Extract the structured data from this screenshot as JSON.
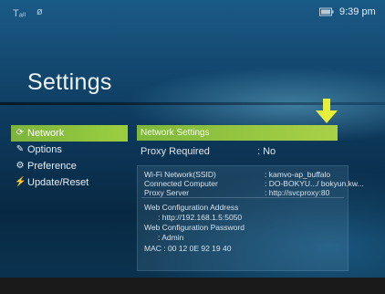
{
  "status": {
    "signal": "Tₐₗₗ",
    "antenna": "ø",
    "battery": "▭",
    "time": "9:39 pm"
  },
  "title": "Settings",
  "menu": [
    {
      "label": "Network",
      "icon": "network-icon",
      "active": true
    },
    {
      "label": "Options",
      "icon": "options-icon",
      "active": false
    },
    {
      "label": "Preference",
      "icon": "preference-icon",
      "active": false
    },
    {
      "label": "Update/Reset",
      "icon": "update-icon",
      "active": false
    }
  ],
  "panel": {
    "header": "Network Settings",
    "proxy_required_label": "Proxy Required",
    "proxy_required_value": ": No",
    "details": {
      "wifi_label": "Wi-Fi Network(SSID)",
      "wifi_value": ": kamvo-ap_buffalo",
      "computer_label": "Connected Computer",
      "computer_value": ": DO-BOKYU.../ bokyun.kw...",
      "proxy_label": "Proxy Server",
      "proxy_value": ": http://svcproxy:80",
      "web_addr_label": "Web Configuration Address",
      "web_addr_value": ": http://192.168.1.5:5050",
      "web_pw_label": "Web Configuration Password",
      "web_pw_value": ": Admin",
      "mac": "MAC : 00 12 0E 92 19 40"
    }
  },
  "colors": {
    "accent_green": "#8cc63f",
    "arrow_yellow": "#e6f03a",
    "background_blue": "#0e3b5f"
  }
}
